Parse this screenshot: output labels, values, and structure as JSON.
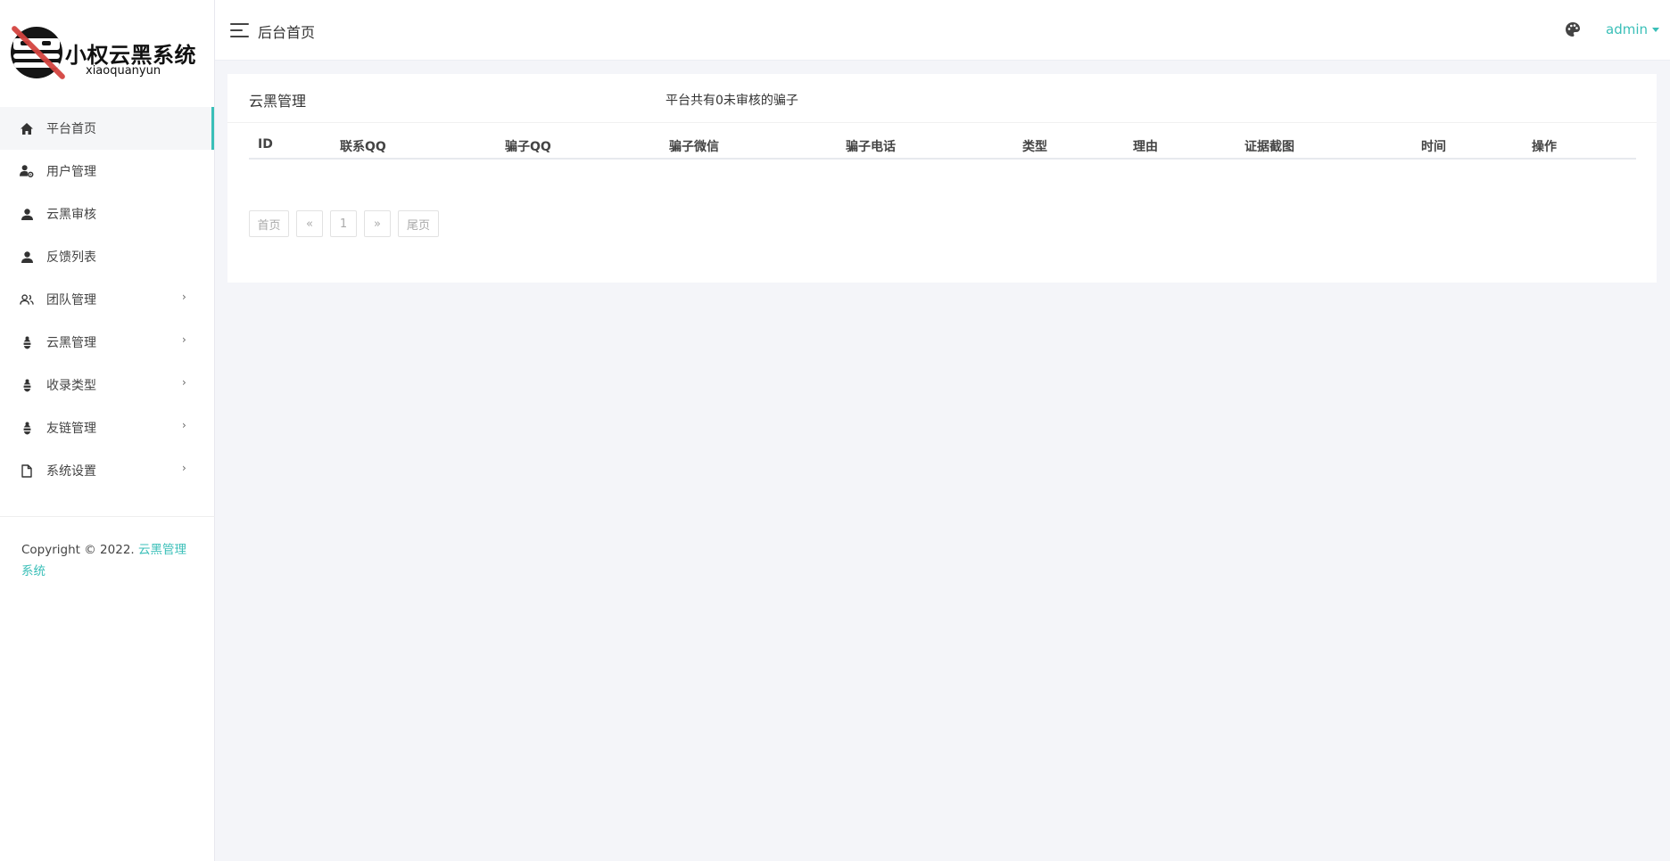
{
  "logo": {
    "title": "小权云黑系统",
    "subtitle": "xiaoquanyun"
  },
  "sidebar": {
    "items": [
      {
        "label": "平台首页",
        "icon": "home-icon",
        "active": true,
        "expandable": false
      },
      {
        "label": "用户管理",
        "icon": "user-settings-icon",
        "active": false,
        "expandable": false
      },
      {
        "label": "云黑审核",
        "icon": "user-icon",
        "active": false,
        "expandable": false
      },
      {
        "label": "反馈列表",
        "icon": "user-icon",
        "active": false,
        "expandable": false
      },
      {
        "label": "团队管理",
        "icon": "group-icon",
        "active": false,
        "expandable": true
      },
      {
        "label": "云黑管理",
        "icon": "bug-icon",
        "active": false,
        "expandable": true
      },
      {
        "label": "收录类型",
        "icon": "bug-icon",
        "active": false,
        "expandable": true
      },
      {
        "label": "友链管理",
        "icon": "bug-icon",
        "active": false,
        "expandable": true
      },
      {
        "label": "系统设置",
        "icon": "file-icon",
        "active": false,
        "expandable": true
      }
    ]
  },
  "footer": {
    "copyright_prefix": "Copyright © 2022. ",
    "brand": "云黑管理系统"
  },
  "header": {
    "page_title": "后台首页",
    "user": "admin"
  },
  "card": {
    "title": "云黑管理",
    "count_text": "平台共有0未审核的骗子",
    "columns": [
      "ID",
      "联系QQ",
      "骗子QQ",
      "骗子微信",
      "骗子电话",
      "类型",
      "理由",
      "证据截图",
      "时间",
      "操作"
    ]
  },
  "pagination": {
    "first": "首页",
    "prev": "«",
    "current": "1",
    "next": "»",
    "last": "尾页"
  },
  "colors": {
    "accent": "#3abfb8",
    "background": "#f4f5f9"
  }
}
